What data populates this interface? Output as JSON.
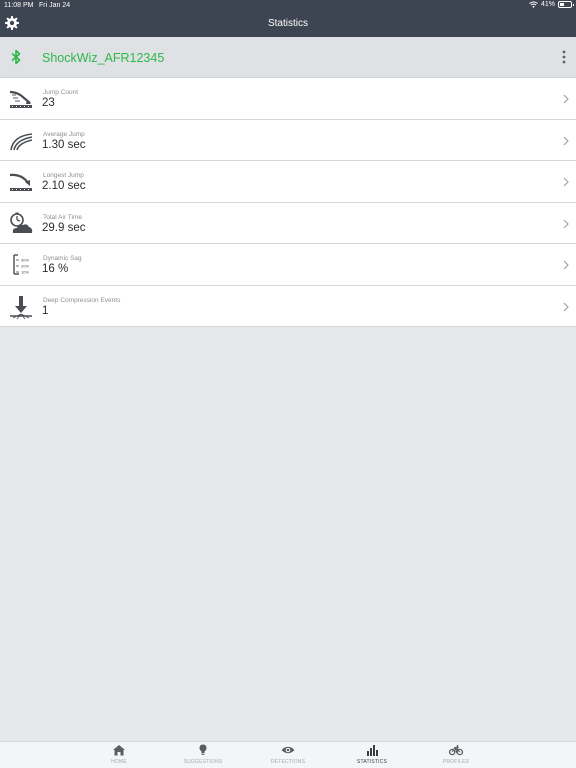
{
  "status_bar": {
    "time": "11:08 PM",
    "date": "Fri Jan 24",
    "battery": "41%",
    "battery_level": 0.41
  },
  "nav": {
    "title": "Statistics"
  },
  "device": {
    "name": "ShockWiz_AFR12345"
  },
  "stats": [
    {
      "label": "Jump Count",
      "value": "23",
      "icon": "jump-count-icon"
    },
    {
      "label": "Average Jump",
      "value": "1.30 sec",
      "icon": "average-jump-icon"
    },
    {
      "label": "Longest Jump",
      "value": "2.10 sec",
      "icon": "longest-jump-icon"
    },
    {
      "label": "Total Air Time",
      "value": "29.9 sec",
      "icon": "air-time-icon"
    },
    {
      "label": "Dynamic Sag",
      "value": "16 %",
      "icon": "dynamic-sag-icon",
      "icon_text": [
        "30%",
        "20%",
        "10%"
      ]
    },
    {
      "label": "Deep Compression Events",
      "value": "1",
      "icon": "deep-compression-icon"
    }
  ],
  "tabs": [
    {
      "label": "HOME",
      "icon": "home-icon",
      "active": false
    },
    {
      "label": "SUGGESTIONS",
      "icon": "lightbulb-icon",
      "active": false
    },
    {
      "label": "DETECTIONS",
      "icon": "eye-icon",
      "active": false
    },
    {
      "label": "STATISTICS",
      "icon": "bar-chart-icon",
      "active": true
    },
    {
      "label": "PROFILES",
      "icon": "bicycle-icon",
      "active": false
    }
  ],
  "colors": {
    "bar": "#3e4552",
    "accent": "#2db84a",
    "background": "#e6e8ea"
  }
}
